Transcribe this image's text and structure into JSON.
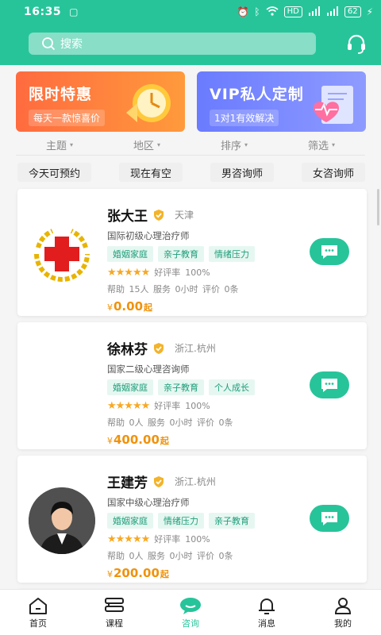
{
  "status": {
    "time": "16:35",
    "network": "HD",
    "battery": "62"
  },
  "search": {
    "placeholder": "搜索"
  },
  "banners": [
    {
      "title": "限时特惠",
      "subtitle": "每天一款惊喜价"
    },
    {
      "title": "VIP私人定制",
      "subtitle": "1对1有效解决"
    }
  ],
  "filters": [
    "主题",
    "地区",
    "排序",
    "筛选"
  ],
  "quick": [
    "今天可预约",
    "现在有空",
    "男咨询师",
    "女咨询师"
  ],
  "counselors": [
    {
      "name": "张大王",
      "city": "天津",
      "title": "国际初级心理治疗师",
      "tags": [
        "婚姻家庭",
        "亲子教育",
        "情绪压力"
      ],
      "rating_label": "好评率",
      "rating": "100%",
      "stats": "帮助 15人 服务 0小时 评价 0条",
      "price": "0.00",
      "price_suffix": "起",
      "avatar": "red-cross-logo"
    },
    {
      "name": "徐林芬",
      "city": "浙江.杭州",
      "title": "国家二级心理咨询师",
      "tags": [
        "婚姻家庭",
        "亲子教育",
        "个人成长"
      ],
      "rating_label": "好评率",
      "rating": "100%",
      "stats": "帮助 0人 服务 0小时 评价 0条",
      "price": "400.00",
      "price_suffix": "起",
      "avatar": "none"
    },
    {
      "name": "王建芳",
      "city": "浙江.杭州",
      "title": "国家中级心理治疗师",
      "tags": [
        "婚姻家庭",
        "情绪压力",
        "亲子教育"
      ],
      "rating_label": "好评率",
      "rating": "100%",
      "stats": "帮助 0人 服务 0小时 评价 0条",
      "price": "200.00",
      "price_suffix": "起",
      "avatar": "person-photo"
    }
  ],
  "currency": "¥",
  "tabs": [
    {
      "label": "首页",
      "icon": "home-icon"
    },
    {
      "label": "课程",
      "icon": "course-icon"
    },
    {
      "label": "咨询",
      "icon": "consult-icon",
      "active": true
    },
    {
      "label": "消息",
      "icon": "bell-icon"
    },
    {
      "label": "我的",
      "icon": "profile-icon"
    }
  ],
  "colors": {
    "brand": "#27c49a",
    "price": "#f0920a",
    "star": "#f7a823"
  }
}
